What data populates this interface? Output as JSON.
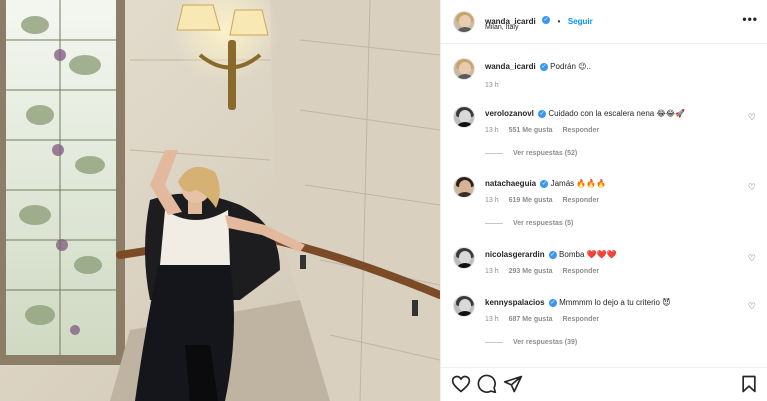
{
  "post": {
    "author": "wanda_icardi",
    "location": "Milan, Italy",
    "follow_label": "Seguir",
    "separator": "•",
    "more_label": "•••",
    "caption_text": "Podrán 😉..",
    "caption_time": "13 h"
  },
  "comments": [
    {
      "user": "verolozanovl",
      "text": "Cuidado con la escalera nena 😂😂🚀",
      "time": "13 h",
      "likes": "551 Me gusta",
      "reply": "Responder",
      "replies": "Ver respuestas (52)",
      "avatar": "gray"
    },
    {
      "user": "natachaeguia",
      "text": "Jamás 🔥🔥🔥",
      "time": "13 h",
      "likes": "619 Me gusta",
      "reply": "Responder",
      "replies": "Ver respuestas (5)",
      "avatar": "dark"
    },
    {
      "user": "nicolasgerardin",
      "text": "Bomba ❤️❤️❤️",
      "time": "13 h",
      "likes": "293 Me gusta",
      "reply": "Responder",
      "replies": "",
      "avatar": "gray"
    },
    {
      "user": "kennyspalacios",
      "text": "Mmmmm lo dejo a tu criterio 😈",
      "time": "13 h",
      "likes": "687 Me gusta",
      "reply": "Responder",
      "replies": "Ver respuestas (39)",
      "avatar": "gray"
    }
  ],
  "icons": {
    "like": "heart-outline-icon",
    "comment": "comment-bubble-icon",
    "share": "paper-plane-icon",
    "save": "bookmark-icon",
    "more": "more-horizontal-icon",
    "verified": "verified-badge-icon",
    "comment_like": "small-heart-icon"
  },
  "colors": {
    "accent": "#0095f6",
    "verified": "#3897f0",
    "text": "#262626",
    "muted": "#8e8e8e",
    "border": "#efefef"
  }
}
